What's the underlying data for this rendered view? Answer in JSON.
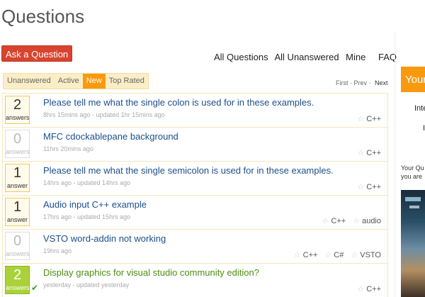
{
  "page": {
    "title": "Questions"
  },
  "actions": {
    "ask_label": "Ask a Question"
  },
  "top_nav": [
    "All Questions",
    "All Unanswered",
    "Mine",
    "FAQ"
  ],
  "filter_tabs": [
    {
      "label": "Unanswered",
      "active": false
    },
    {
      "label": "Active",
      "active": false
    },
    {
      "label": "New",
      "active": true
    },
    {
      "label": "Top Rated",
      "active": false
    }
  ],
  "pager": {
    "first": "First",
    "prev": "Prev",
    "next": "Next"
  },
  "questions": [
    {
      "count": "2",
      "count_label": "answers",
      "state": "answered",
      "title": "Please tell me what the single colon is used for in these examples.",
      "meta": "8hrs 15mins ago - updated 1hr 15mins ago",
      "tags": [
        "C++"
      ]
    },
    {
      "count": "0",
      "count_label": "answers",
      "state": "zero",
      "title": "MFC cdockablepane background",
      "meta": "11hrs 20mins ago",
      "tags": [
        "C++"
      ]
    },
    {
      "count": "1",
      "count_label": "answer",
      "state": "answered",
      "title": "Please tell me what the single semicolon is used for in these examples.",
      "meta": "14hrs ago - updated 14hrs ago",
      "tags": [
        "C++"
      ]
    },
    {
      "count": "1",
      "count_label": "answer",
      "state": "answered",
      "title": "Audio input C++ example",
      "meta": "17hrs ago - updated 15hrs ago",
      "tags": [
        "C++",
        "audio"
      ]
    },
    {
      "count": "0",
      "count_label": "answers",
      "state": "zero",
      "title": "VSTO word-addin not working",
      "meta": "19hrs ago",
      "tags": [
        "C++",
        "C#",
        "VSTO"
      ]
    },
    {
      "count": "2",
      "count_label": "answers",
      "state": "accepted",
      "title": "Display graphics for visual studio community edition?",
      "meta": "yesterday - updated yesterday",
      "tags": [
        "C++"
      ]
    }
  ],
  "sidebar": {
    "box_text": "Your",
    "frag1": "Inte",
    "frag2": "I",
    "text_line1": "Your Qu",
    "text_line2": "you are"
  },
  "colors": {
    "accent": "#f99a0e",
    "ask_button": "#d9442f",
    "link": "#1c4f8a",
    "accepted": "#a9d23a"
  }
}
